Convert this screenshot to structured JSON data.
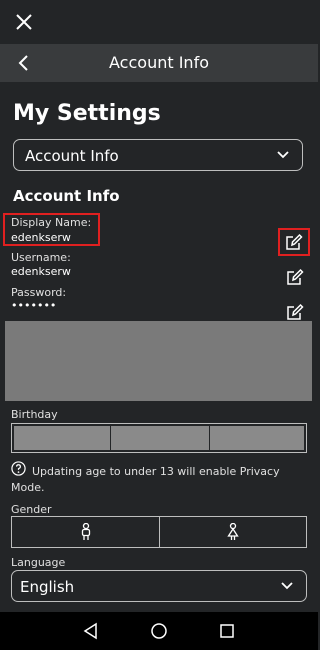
{
  "header": {
    "title": "Account Info"
  },
  "page_title": "My Settings",
  "settings_dropdown": {
    "selected": "Account Info"
  },
  "section_title": "Account Info",
  "fields": {
    "display_name": {
      "label": "Display Name:",
      "value": "edenkserw"
    },
    "username": {
      "label": "Username:",
      "value": "edenkserw"
    },
    "password": {
      "label": "Password:",
      "value": "•••••••"
    }
  },
  "birthday": {
    "label": "Birthday"
  },
  "privacy_note": "Updating age to under 13 will enable Privacy Mode.",
  "gender": {
    "label": "Gender"
  },
  "language": {
    "label": "Language",
    "selected": "English"
  },
  "colors": {
    "background": "#232527",
    "header": "#393b3d",
    "highlight": "#e02020",
    "navbar": "#000000"
  },
  "icons": [
    "close-icon",
    "back-arrow-icon",
    "chevron-down-icon",
    "edit-icon",
    "help-icon",
    "male-icon",
    "female-icon",
    "nav-back-icon",
    "nav-home-icon",
    "nav-recents-icon"
  ]
}
